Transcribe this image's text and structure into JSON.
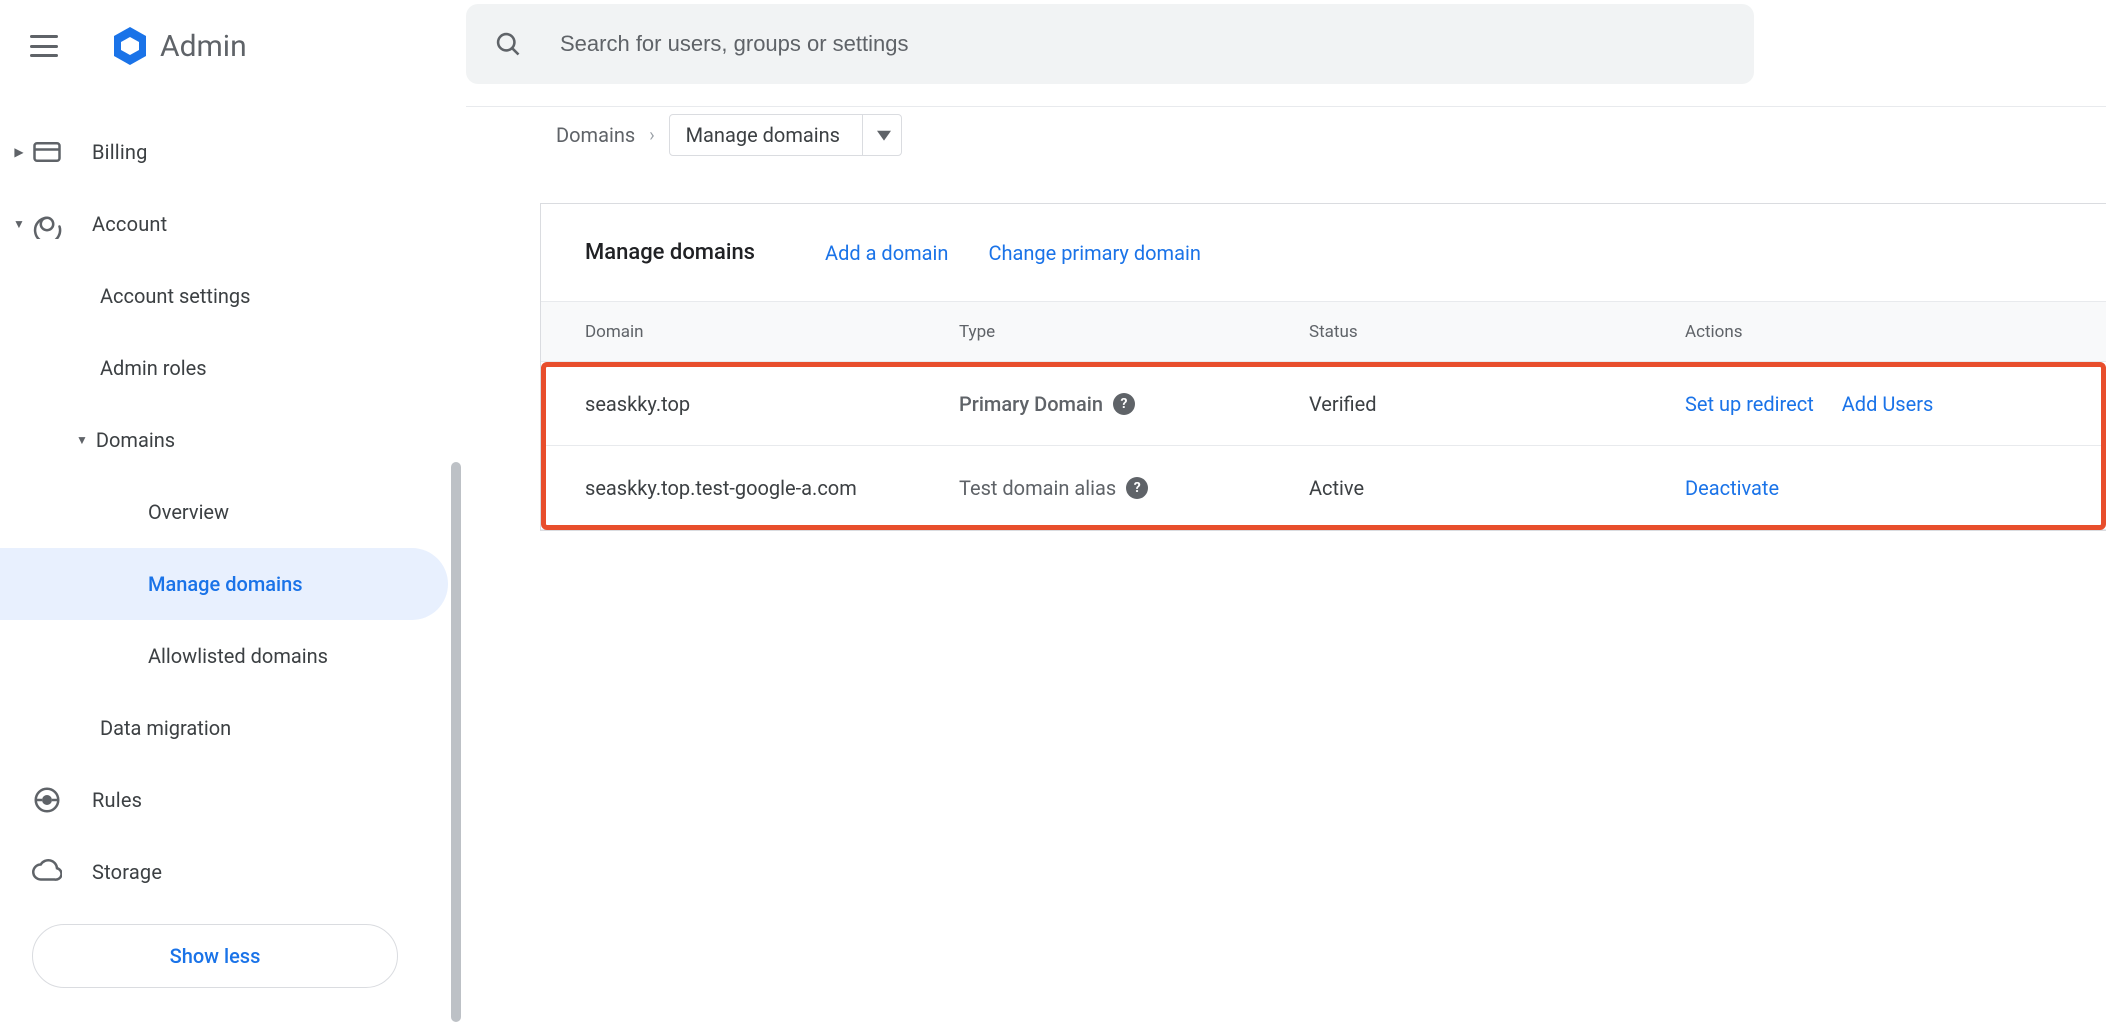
{
  "header": {
    "app_name": "Admin",
    "search_placeholder": "Search for users, groups or settings"
  },
  "sidebar": {
    "billing": "Billing",
    "account": "Account",
    "account_settings": "Account settings",
    "admin_roles": "Admin roles",
    "domains": "Domains",
    "overview": "Overview",
    "manage_domains": "Manage domains",
    "allowlisted_domains": "Allowlisted domains",
    "data_migration": "Data migration",
    "rules": "Rules",
    "storage": "Storage",
    "show_less": "Show less"
  },
  "breadcrumb": {
    "parent": "Domains",
    "current": "Manage domains"
  },
  "card": {
    "title": "Manage domains",
    "add_domain": "Add a domain",
    "change_primary": "Change primary domain"
  },
  "table": {
    "headers": {
      "domain": "Domain",
      "type": "Type",
      "status": "Status",
      "actions": "Actions"
    },
    "rows": [
      {
        "domain": "seaskky.top",
        "type": "Primary Domain",
        "type_bold": true,
        "has_help": true,
        "status": "Verified",
        "actions": [
          "Set up redirect",
          "Add Users"
        ]
      },
      {
        "domain": "seaskky.top.test-google-a.com",
        "type": "Test domain alias",
        "type_bold": false,
        "has_help": true,
        "status": "Active",
        "actions": [
          "Deactivate"
        ]
      }
    ]
  },
  "icons": {
    "help": "?"
  }
}
